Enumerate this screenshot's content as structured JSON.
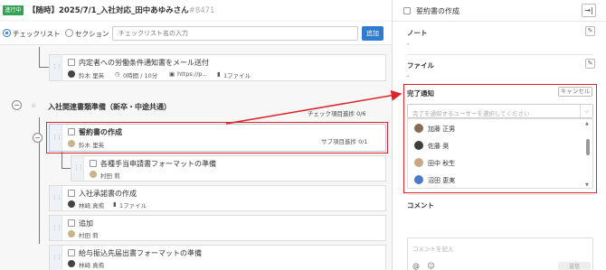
{
  "header": {
    "status": "進行中",
    "title": "【随時】2025/7/1_入社対応_田中あゆみさん",
    "ticket_id": "#8471"
  },
  "toolbar": {
    "checklist_label": "チェックリスト",
    "section_label": "セクション",
    "search_placeholder": "チェックリスト名の入力",
    "add_label": "追加"
  },
  "items": {
    "labor_notice": {
      "title": "内定者への労働条件通知書をメール送付",
      "assignee": "鈴木 里英",
      "time": "0時間 / 10分",
      "link": "https://p…",
      "files": "1ファイル"
    },
    "section": {
      "title": "入社関連書類準備（新卒・中途共通）",
      "progress": "チェック項目進捗 0/6"
    },
    "oath": {
      "title": "誓約書の作成",
      "assignee": "鈴木 里英",
      "sub_progress": "サブ項目進捗 0/1"
    },
    "allowance": {
      "title": "各種手当申請書フォーマットの準備",
      "assignee": "村田 莉"
    },
    "consent": {
      "title": "入社承諾書の作成",
      "assignee": "林崎 真侑",
      "files": "1ファイル"
    },
    "add": {
      "title": "追加",
      "assignee": "村田 莉"
    },
    "bank": {
      "title": "給与振込先届出書フォーマットの準備",
      "assignee": "林崎 真侑"
    }
  },
  "panel": {
    "title": "誓約書の作成",
    "close_icon": "→|",
    "note_label": "ノート",
    "note_value": "-",
    "file_label": "ファイル",
    "file_value": "-",
    "notify_label": "完了通知",
    "cancel_label": "キャンセル",
    "user_placeholder": "完了を通知するユーザーを選択してください",
    "users": [
      "加藤 正男",
      "佐藤 奨",
      "田中 秋生",
      "沼田 恵実"
    ],
    "comment_label": "コメント",
    "comment_placeholder": "コメントを記入",
    "send_label": "送信",
    "mention_icon": "@",
    "emoji_icon": "☺"
  },
  "colors": {
    "status_green": "#31a354",
    "accent_blue": "#2e7bcf",
    "highlight_red": "#d9252b"
  }
}
